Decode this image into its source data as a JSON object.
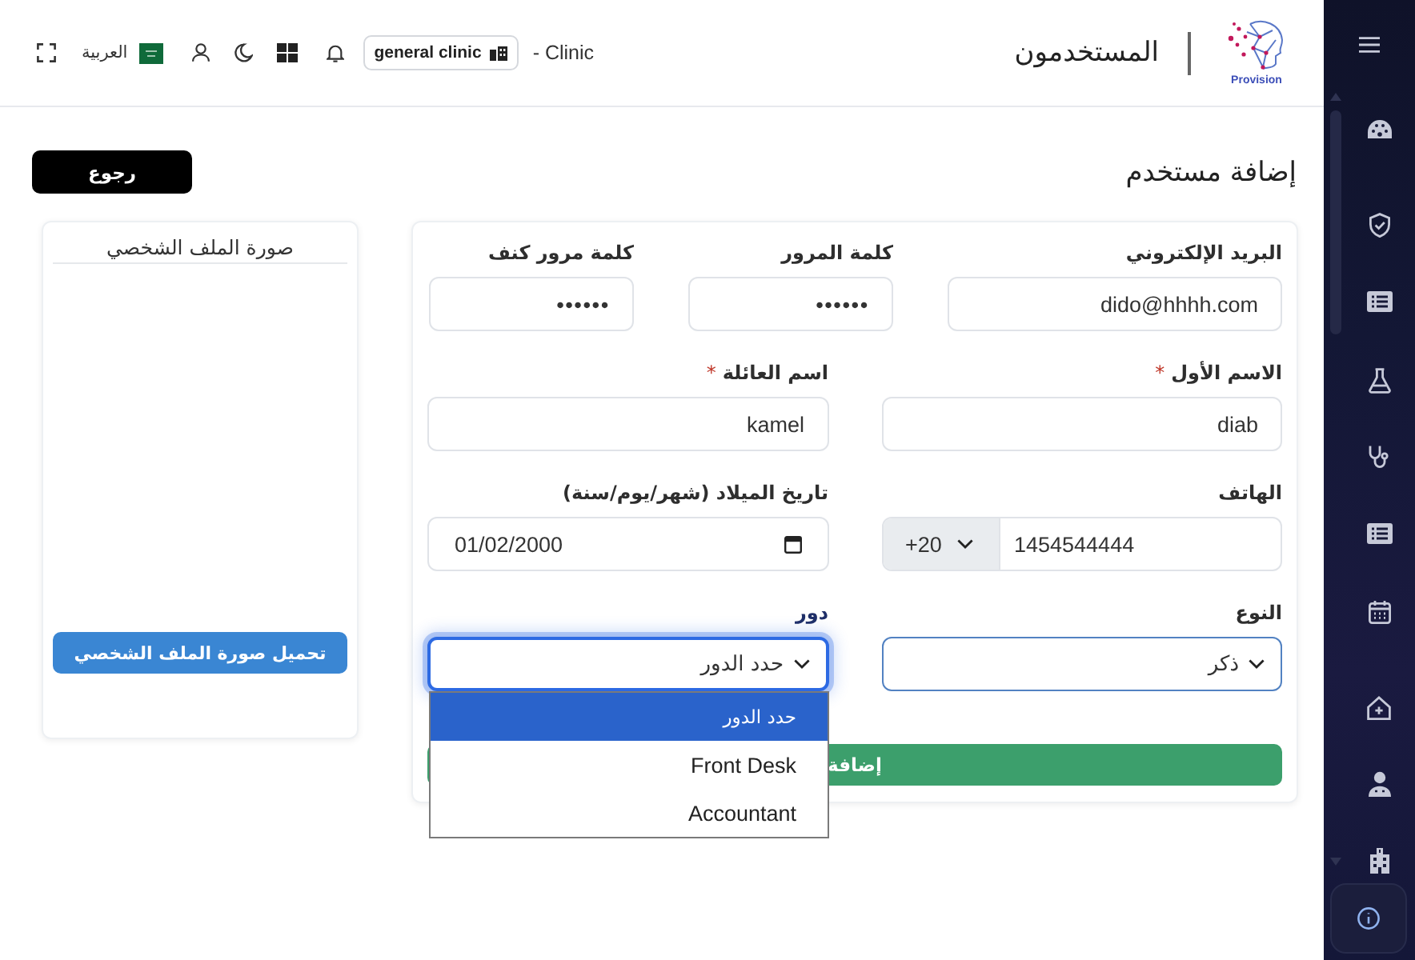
{
  "header": {
    "clinic_label": "- Clinic",
    "clinic_chip": "general clinic",
    "language": "العربية",
    "title": "المستخدمون",
    "logo_text": "Provision"
  },
  "page": {
    "title": "إضافة مستخدم",
    "back_button": "رجوع"
  },
  "form": {
    "rows": [
      [
        {
          "kind": "text",
          "label": "البريد الإلكتروني",
          "value": "dido@hhhh.com"
        },
        {
          "kind": "password",
          "label": "كلمة المرور",
          "value": "••••••"
        },
        {
          "kind": "password",
          "label": "كلمة مرور كنف",
          "value": "••••••"
        }
      ],
      [
        {
          "kind": "text",
          "label": "الاسم الأول",
          "required_mark": "*",
          "value": "diab"
        },
        {
          "kind": "text",
          "label": "اسم العائلة",
          "required_mark": "*",
          "value": "kamel"
        }
      ],
      [
        {
          "kind": "phone",
          "label": "الهاتف",
          "country_code": "+20",
          "value": "1454544444"
        },
        {
          "kind": "date",
          "label": "تاريخ الميلاد (شهر/يوم/سنة)",
          "value": "01/02/2000"
        }
      ],
      [
        {
          "kind": "select",
          "label": "النوع",
          "value": "ذكر",
          "focused": false
        },
        {
          "kind": "select",
          "label": "دور",
          "value": "حدد الدور",
          "focused": true,
          "open": true,
          "options": [
            {
              "label": "حدد الدور",
              "selected": true
            },
            {
              "label": "Front Desk",
              "selected": false
            },
            {
              "label": "Accountant",
              "selected": false
            }
          ]
        }
      ]
    ],
    "submit_button": "إضافة"
  },
  "profile": {
    "title": "صورة الملف الشخصي",
    "upload_button": "تحميل صورة الملف الشخصي"
  }
}
